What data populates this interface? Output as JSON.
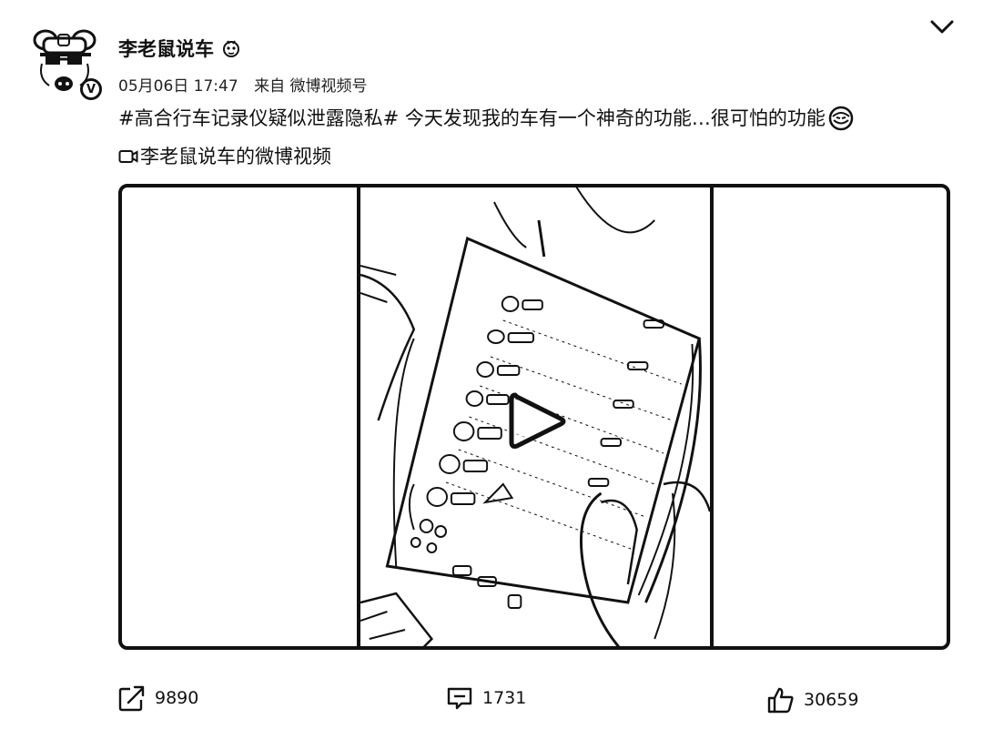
{
  "post": {
    "author": "李老鼠说车",
    "date": "05月06日 17:47",
    "source": "来自 微博视频号",
    "hashtag": "#高合行车记录仪疑似泄露隐私#",
    "text": "今天发现我的车有一个神奇的功能…很可怕的功能",
    "video_link_label": "李老鼠说车的微博视频"
  },
  "actions": {
    "share_count": "9890",
    "comment_count": "1731",
    "like_count": "30659"
  },
  "icons": {
    "avatar": "cartoon-avatar",
    "verified": "verified-v-icon",
    "collapse": "chevron-down-icon",
    "play": "play-icon",
    "share": "share-icon",
    "comment": "comment-icon",
    "like": "thumbs-up-icon"
  },
  "verified_badge": "V"
}
